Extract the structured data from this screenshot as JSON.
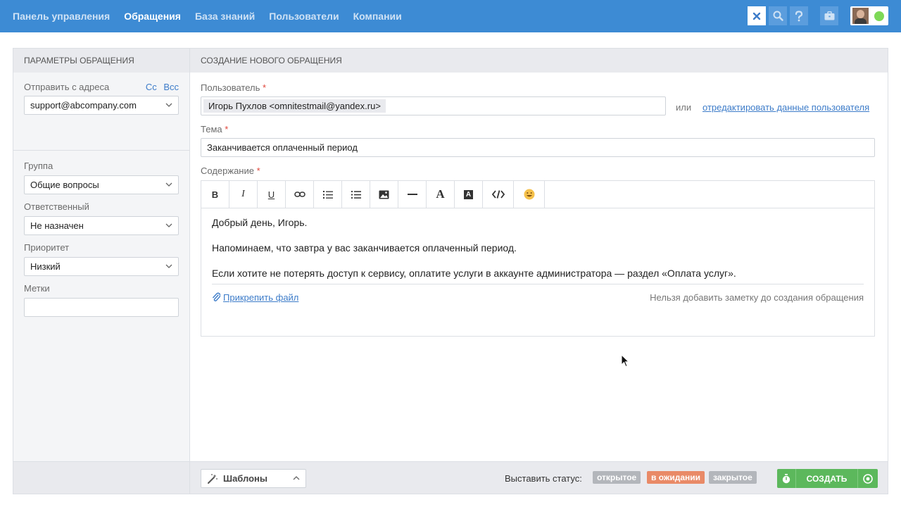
{
  "nav": {
    "items": [
      {
        "label": "Панель управления"
      },
      {
        "label": "Обращения"
      },
      {
        "label": "База знаний"
      },
      {
        "label": "Пользователи"
      },
      {
        "label": "Компании"
      }
    ],
    "active_index": 1
  },
  "colors": {
    "topbar": "#3d8bd4",
    "accent": "#3d7cc9",
    "status_open": "#b3b6bb",
    "status_pending": "#e98a67",
    "status_closed": "#b3b6bb",
    "create": "#5cb85c",
    "online": "#7ed957"
  },
  "topbar_icons": [
    "close-icon",
    "search-icon",
    "help-icon",
    "briefcase-icon"
  ],
  "sidebar": {
    "title": "Параметры обращения",
    "from_label": "Отправить с адреса",
    "cc_label": "Cc",
    "bcc_label": "Bcc",
    "from_value": "support@abcompany.com",
    "group_label": "Группа",
    "group_value": "Общие вопросы",
    "assignee_label": "Ответственный",
    "assignee_value": "Не назначен",
    "priority_label": "Приоритет",
    "priority_value": "Низкий",
    "tags_label": "Метки",
    "tags_value": ""
  },
  "main": {
    "title": "Создание нового обращения",
    "user_label": "Пользователь",
    "required_mark": "*",
    "user_chip": "Игорь Пухлов <omnitestmail@yandex.ru>",
    "or_text": "или",
    "edit_user_link": "отредактировать данные пользователя",
    "subject_label": "Тема",
    "subject_value": "Заканчивается оплаченный период",
    "content_label": "Содержание",
    "toolbar": [
      "bold-icon",
      "italic-icon",
      "underline-icon",
      "link-icon",
      "ordered-list-icon",
      "unordered-list-icon",
      "image-icon",
      "horizontal-rule-icon",
      "font-icon",
      "text-color-icon",
      "code-icon",
      "emoji-icon"
    ],
    "body": {
      "p1": "Добрый день, Игорь.",
      "p2": "Напоминаем, что завтра у вас заканчивается оплаченный период.",
      "p3": "Если хотите не потерять доступ к сервису, оплатите услуги в аккаунте администратора — раздел «Оплата услуг»."
    },
    "attach_label": "Прикрепить файл",
    "note_text": "Нельзя добавить заметку до создания обращения"
  },
  "footer": {
    "templates_label": "Шаблоны",
    "status_label": "Выставить статус:",
    "statuses": [
      "открытое",
      "в ожидании",
      "закрытое"
    ],
    "create_label": "СОЗДАТЬ"
  }
}
